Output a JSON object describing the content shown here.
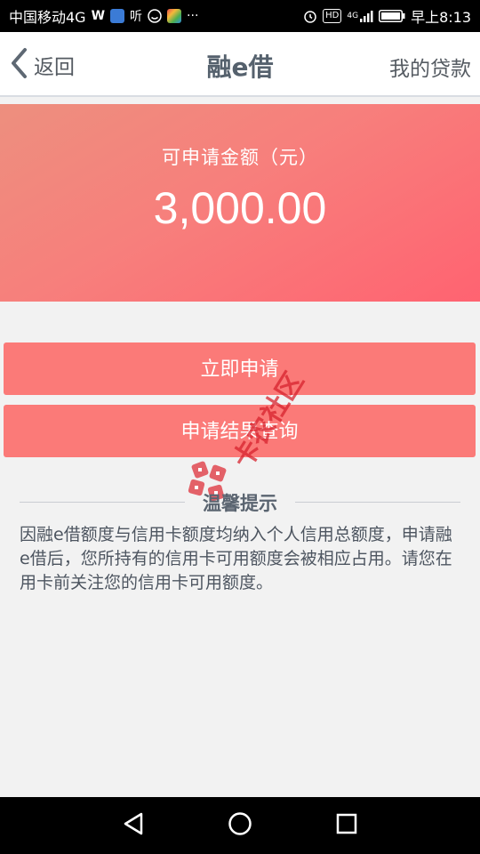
{
  "status_bar": {
    "carrier": "中国移动4G",
    "app_icon_w": "W",
    "app_icon_ting": "听",
    "more": "···",
    "hd_badge": "HD",
    "network": "4G",
    "time": "早上8:13"
  },
  "nav": {
    "back_label": "返回",
    "title": "融e借",
    "my_loans": "我的贷款"
  },
  "amount_card": {
    "label": "可申请金额（元）",
    "value": "3,000.00"
  },
  "buttons": {
    "apply": "立即申请",
    "query": "申请结果查询"
  },
  "watermark": {
    "text": "卡农社区"
  },
  "tips": {
    "title": "温馨提示",
    "body": "因融e借额度与信用卡额度均纳入个人信用总额度，申请融e借后，您所持有的信用卡可用额度会被相应占用。请您在用卡前关注您的信用卡可用额度。"
  },
  "colors": {
    "accent_button": "#fb7a78",
    "card_gradient_start": "#ed8f7e",
    "card_gradient_end": "#ff6371",
    "background": "#f2f2f2"
  }
}
